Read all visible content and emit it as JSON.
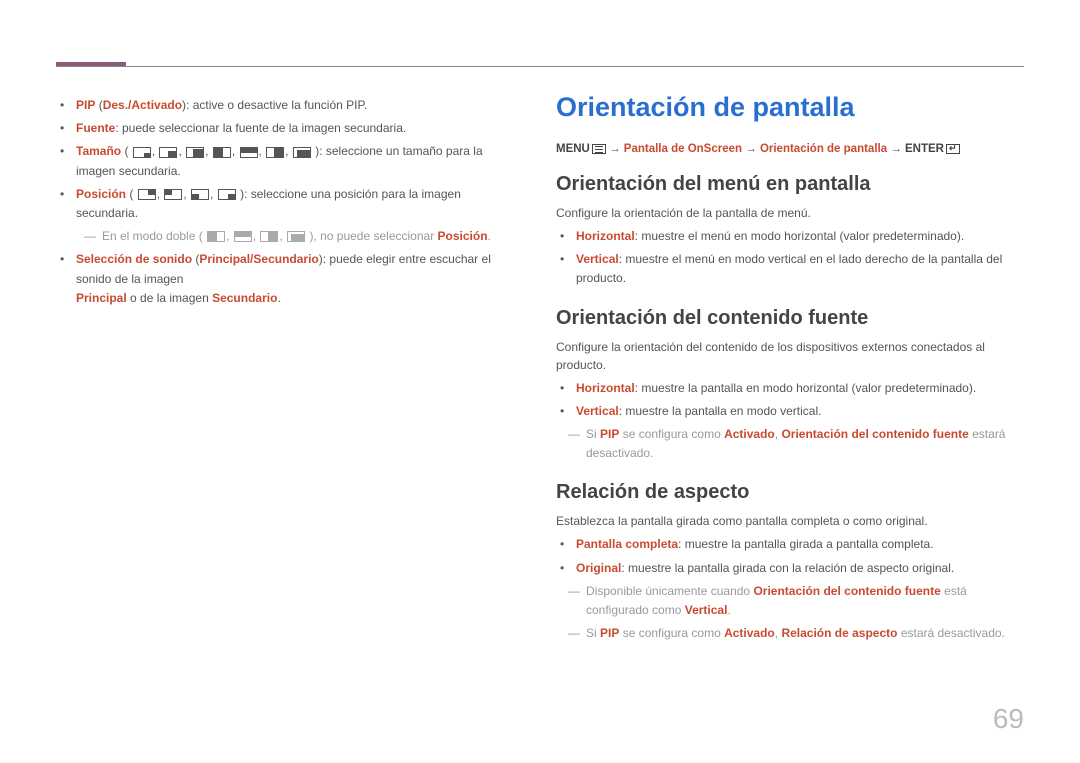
{
  "left": {
    "items": [
      {
        "label": "PIP",
        "paren": "Des./Activado",
        "rest": ": active o desactive la función PIP."
      },
      {
        "label": "Fuente",
        "rest": ": puede seleccionar la fuente de la imagen secundaria."
      },
      {
        "label": "Tamaño",
        "icons": true,
        "rest": ": seleccione un tamaño para la imagen secundaria."
      },
      {
        "label": "Posición",
        "icons2": true,
        "rest": ": seleccione una posición para la imagen secundaria."
      }
    ],
    "subnote_a": "En el modo doble (",
    "subnote_b": "), no puede seleccionar ",
    "subnote_c": "Posición",
    "subnote_d": ".",
    "sound_a": "Selección de sonido",
    "sound_b": "Principal/Secundario",
    "sound_rest": ": puede elegir entre escuchar el sonido de la imagen ",
    "sound_line2_a": "Principal",
    "sound_line2_mid": " o de la imagen ",
    "sound_line2_b": "Secundario",
    "sound_line2_end": "."
  },
  "right": {
    "h1": "Orientación de pantalla",
    "bc_menu": "MENU",
    "bc_arrow": " → ",
    "bc_a": "Pantalla de OnScreen",
    "bc_b": "Orientación de pantalla",
    "bc_enter": "ENTER",
    "h2a": "Orientación del menú en pantalla",
    "p_a": "Configure la orientación de la pantalla de menú.",
    "a_items": [
      {
        "label": "Horizontal",
        "rest": ": muestre el menú en modo horizontal (valor predeterminado)."
      },
      {
        "label": "Vertical",
        "rest": ": muestre el menú en modo vertical en el lado derecho de la pantalla del producto."
      }
    ],
    "h2b": "Orientación del contenido fuente",
    "p_b": "Configure la orientación del contenido de los dispositivos externos conectados al producto.",
    "b_items": [
      {
        "label": "Horizontal",
        "rest": ": muestre la pantalla en modo horizontal (valor predeterminado)."
      },
      {
        "label": "Vertical",
        "rest": ": muestre la pantalla en modo vertical."
      }
    ],
    "note_b_pre": "Si ",
    "note_b_pip": "PIP",
    "note_b_mid": " se configura como ",
    "note_b_act": "Activado",
    "note_b_sep": ", ",
    "note_b_oc": "Orientación del contenido fuente",
    "note_b_end": " estará desactivado.",
    "h2c": "Relación de aspecto",
    "p_c": "Establezca la pantalla girada como pantalla completa o como original.",
    "c_items": [
      {
        "label": "Pantalla completa",
        "rest": ": muestre la pantalla girada a pantalla completa."
      },
      {
        "label": "Original",
        "rest": ": muestre la pantalla girada con la relación de aspecto original."
      }
    ],
    "note_c1_pre": "Disponible únicamente cuando ",
    "note_c1_oc": "Orientación del contenido fuente",
    "note_c1_mid": " está configurado como ",
    "note_c1_v": "Vertical",
    "note_c1_end": ".",
    "note_c2_pre": "Si ",
    "note_c2_pip": "PIP",
    "note_c2_mid": " se configura como ",
    "note_c2_act": "Activado",
    "note_c2_sep": ", ",
    "note_c2_ra": "Relación de aspecto",
    "note_c2_end": " estará desactivado."
  },
  "page_number": "69"
}
